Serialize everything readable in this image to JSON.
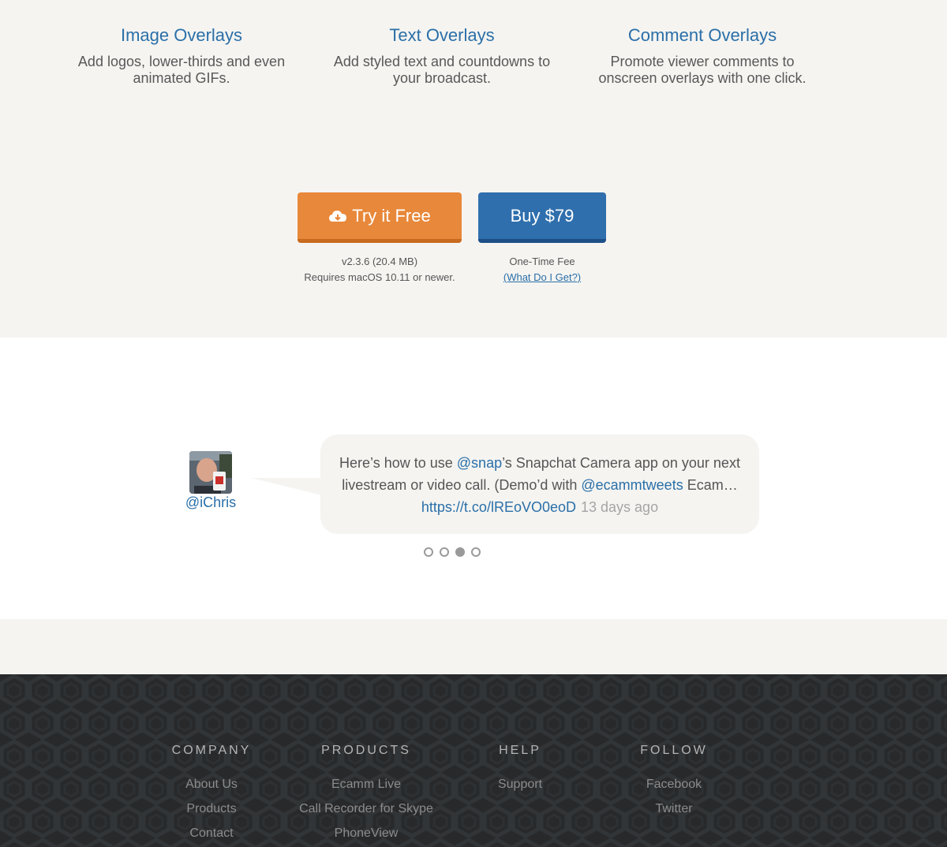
{
  "features": [
    {
      "title": "Image Overlays",
      "description": "Add logos, lower-thirds and even animated GIFs.",
      "icon": "image-icon"
    },
    {
      "title": "Text Overlays",
      "description": "Add styled text and countdowns to your broadcast.",
      "icon": "text-icon"
    },
    {
      "title": "Comment Overlays",
      "description": "Promote viewer comments to onscreen overlays with one click.",
      "icon": "comment-icon"
    }
  ],
  "cta": {
    "try_label": "Try it Free",
    "buy_label": "Buy $79",
    "version": "v2.3.6 (20.4 MB)",
    "requirements": "Requires macOS 10.11 or newer.",
    "fee": "One-Time Fee",
    "what_link": "(What Do I Get?)"
  },
  "testimonial": {
    "handle": "@iChris",
    "text_1": "Here’s how to use ",
    "mention_1": "@snap",
    "text_2": "’s Snapchat Camera app on your next livestream or video call. (Demo’d with ",
    "mention_2": "@ecammtweets",
    "text_3": " Ecam…",
    "link": "https://t.co/lREoVO0eoD",
    "ago": "13 days ago",
    "dots_total": 4,
    "dots_active": 3
  },
  "footer": {
    "columns": [
      {
        "heading": "COMPANY",
        "links": [
          "About Us",
          "Products",
          "Contact"
        ]
      },
      {
        "heading": "PRODUCTS",
        "links": [
          "Ecamm Live",
          "Call Recorder for Skype",
          "PhoneView"
        ]
      },
      {
        "heading": "HELP",
        "links": [
          "Support"
        ]
      },
      {
        "heading": "FOLLOW",
        "links": [
          "Facebook",
          "Twitter"
        ]
      }
    ]
  },
  "colors": {
    "accent": "#2a6fa8",
    "try_button": "#e8883a",
    "buy_button": "#2f6fad",
    "footer_bg": "#27292b",
    "page_bg": "#f5f4f1"
  }
}
